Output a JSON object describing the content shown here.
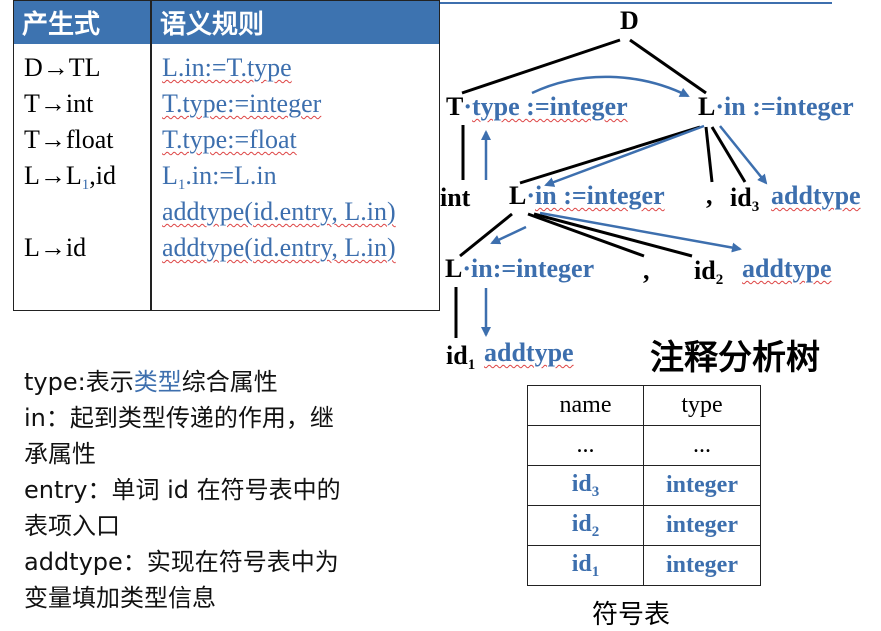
{
  "rules_table": {
    "header": {
      "production": "产生式",
      "semantic": "语义规则"
    },
    "rows": [
      {
        "prod_a": "D→TL",
        "sem": "L.in:=T.type"
      },
      {
        "prod_a": "T→int",
        "sem": "T.type:=integer"
      },
      {
        "prod_a": "T→float",
        "sem": "T.type:=float"
      },
      {
        "prod_a": "L→L",
        "prod_sub": "1",
        "prod_b": ",id",
        "sem_a": "L",
        "sem_sub": "1",
        "sem_b": ".in:=L.in",
        "sem_extra": "addtype(id.entry, L.in)"
      },
      {
        "prod_a": "L→id",
        "sem": "addtype(id.entry, L.in)"
      }
    ]
  },
  "tree": {
    "title": "注释分析树",
    "root": "D",
    "t_label": "T",
    "t_attr": "type :=integer",
    "l_label": "L",
    "l_attr": "in :=integer",
    "int_label": "int",
    "l2_label": "L",
    "l2_attr": "in :=integer",
    "comma1": ",",
    "id3": "id",
    "id3_sub": "3",
    "id3_action": "addtype",
    "l3_label": "L",
    "l3_attr": "in:=integer",
    "comma2": ",",
    "id2": "id",
    "id2_sub": "2",
    "id2_action": "addtype",
    "id1": "id",
    "id1_sub": "1",
    "id1_action": "addtype",
    "dot": "·"
  },
  "notes": {
    "line1_a": "type:表示",
    "line1_b": "类型",
    "line1_c": "综合属性",
    "line2": "in：起到类型传递的作用，继",
    "line3": "承属性",
    "line4": "entry：单词 id 在符号表中的",
    "line5": "表项入口",
    "line6": "addtype：实现在符号表中为",
    "line7": "变量填加类型信息"
  },
  "symbol_table": {
    "caption": "符号表",
    "headers": [
      "name",
      "type"
    ],
    "rows": [
      {
        "name": "...",
        "type": "..."
      },
      {
        "name": "id",
        "sub": "3",
        "type": "integer"
      },
      {
        "name": "id",
        "sub": "2",
        "type": "integer"
      },
      {
        "name": "id",
        "sub": "1",
        "type": "integer"
      }
    ]
  },
  "colors": {
    "header_bg": "#3d73b0",
    "semantic_blue": "#3d6fae",
    "spell_red": "#d44"
  }
}
